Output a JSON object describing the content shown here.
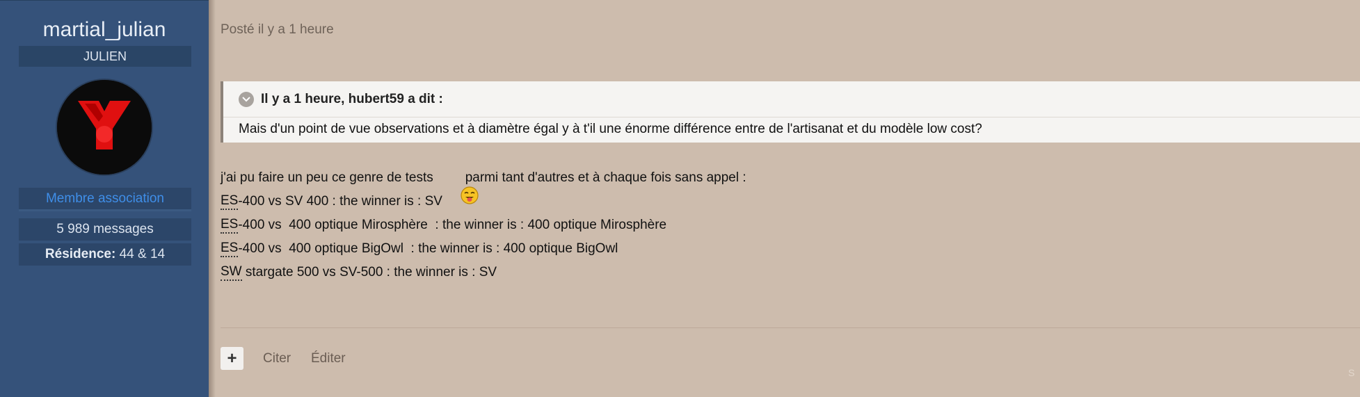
{
  "author": {
    "username": "martial_julian",
    "title": "JULIEN",
    "group": "Membre association",
    "messages": "5 989 messages",
    "residence_label": "Résidence:",
    "residence_value": "44 & 14"
  },
  "post": {
    "date": "Posté il y a 1 heure",
    "quote": {
      "header": "Il y a 1 heure, hubert59 a dit :",
      "text": "Mais d'un point de vue observations et à diamètre égal y à t'il une énorme différence entre de l'artisanat et du modèle low cost?"
    },
    "intro_before": "j'ai pu faire un peu ce genre de tests",
    "intro_after": "parmi tant d'autres et à chaque fois sans appel :",
    "lines": [
      {
        "abbr": "ES",
        "text": "-400 vs SV 400 : the winner is : SV"
      },
      {
        "abbr": "ES",
        "text": "-400 vs  400 optique Mirosphère  : the winner is : 400 optique Mirosphère"
      },
      {
        "abbr": "ES",
        "text": "-400 vs  400 optique BigOwl  : the winner is : 400 optique BigOwl"
      },
      {
        "abbr": "SW",
        "text": " stargate 500 vs SV-500 : the winner is : SV"
      }
    ]
  },
  "actions": {
    "plus": "+",
    "cite": "Citer",
    "edit": "Éditer"
  },
  "corner": "S",
  "colors": {
    "sidebar": "#35527a",
    "background": "#cdbcad",
    "group_link": "#3f8ee8"
  },
  "icons": {
    "avatar": "red-y-logo",
    "quote_toggle": "chevron-down-icon",
    "smiley": "tongue-out-smiley-icon"
  }
}
